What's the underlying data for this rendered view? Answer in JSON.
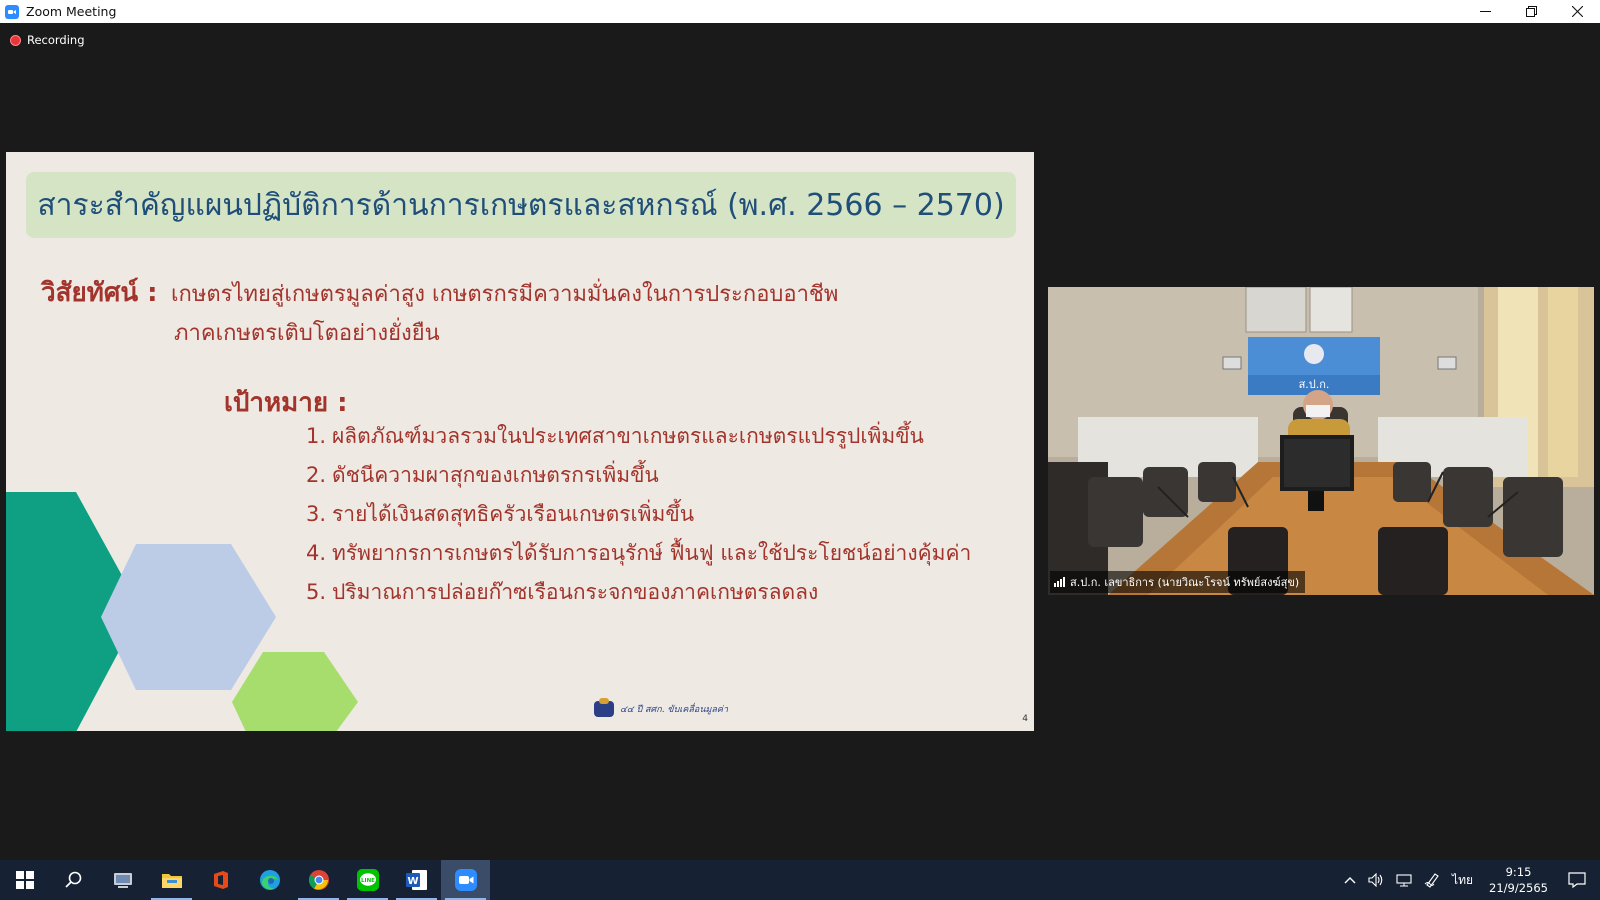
{
  "window": {
    "title": "Zoom Meeting"
  },
  "recording": {
    "label": "Recording"
  },
  "slide": {
    "title": "สาระสำคัญแผนปฏิบัติการด้านการเกษตรและสหกรณ์ (พ.ศ. 2566 – 2570)",
    "vision_label": "วิสัยทัศน์ :",
    "vision_line1": "เกษตรไทยสู่เกษตรมูลค่าสูง  เกษตรกรมีความมั่นคงในการประกอบอาชีพ",
    "vision_line2": "ภาคเกษตรเติบโตอย่างยั่งยืน",
    "goals_label": "เป้าหมาย :",
    "goals": [
      {
        "num": "1.",
        "text": "ผลิตภัณฑ์มวลรวมในประเทศสาขาเกษตรและเกษตรแปรรูปเพิ่มขึ้น"
      },
      {
        "num": "2.",
        "text": "ดัชนีความผาสุกของเกษตรกรเพิ่มขึ้น"
      },
      {
        "num": "3.",
        "text": "รายได้เงินสดสุทธิครัวเรือนเกษตรเพิ่มขึ้น"
      },
      {
        "num": "4.",
        "text": "ทรัพยากรการเกษตรได้รับการอนุรักษ์ ฟื้นฟู และใช้ประโยชน์อย่างคุ้มค่า"
      },
      {
        "num": "5.",
        "text": "ปริมาณการปล่อยก๊าซเรือนกระจกของภาคเกษตรลดลง"
      }
    ],
    "footer_text": "๔๔ ปี สศก. ขับเคลื่อนมูลค่า",
    "page_number": "4",
    "colors": {
      "title": "#1f4e79",
      "body": "#a2342c",
      "header_bg": "#d6e4c6"
    }
  },
  "video": {
    "participant_name": "ส.ป.ก. เลขาธิการ (นายวิณะโรจน์ ทรัพย์สงฆ์สุข)",
    "sign_text": "ส.ป.ก."
  },
  "taskbar": {
    "apps": [
      "start-icon",
      "search-icon",
      "network-app-icon",
      "file-explorer-icon",
      "office-icon",
      "edge-icon",
      "chrome-icon",
      "line-icon",
      "word-icon",
      "zoom-icon"
    ],
    "language": "ไทย",
    "time": "9:15",
    "date": "21/9/2565"
  }
}
